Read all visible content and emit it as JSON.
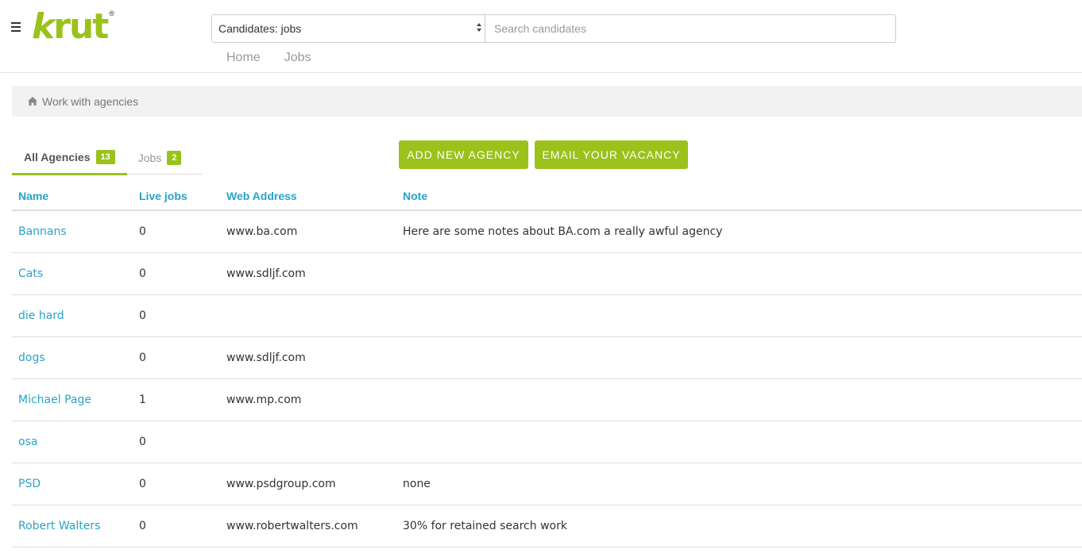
{
  "header": {
    "logo_text_k": "k",
    "logo_text_rut": "rut",
    "logo_registered": "®",
    "search_scope": "Candidates: jobs",
    "search_placeholder": "Search candidates",
    "nav": [
      "Home",
      "Jobs"
    ]
  },
  "breadcrumb": {
    "label": "Work with agencies"
  },
  "tabs": [
    {
      "label": "All Agencies",
      "count": "13"
    },
    {
      "label": "Jobs",
      "count": "2"
    }
  ],
  "buttons": {
    "add_agency": "ADD NEW AGENCY",
    "email_vacancy": "EMAIL YOUR VACANCY"
  },
  "table": {
    "columns": [
      "Name",
      "Live jobs",
      "Web Address",
      "Note"
    ],
    "rows": [
      {
        "name": "Bannans",
        "jobs": "0",
        "web": "www.ba.com",
        "note": "Here are some notes about BA.com a really awful agency"
      },
      {
        "name": "Cats",
        "jobs": "0",
        "web": "www.sdljf.com",
        "note": ""
      },
      {
        "name": "die hard",
        "jobs": "0",
        "web": "",
        "note": ""
      },
      {
        "name": "dogs",
        "jobs": "0",
        "web": "www.sdljf.com",
        "note": ""
      },
      {
        "name": "Michael Page",
        "jobs": "1",
        "web": "www.mp.com",
        "note": ""
      },
      {
        "name": "osa",
        "jobs": "0",
        "web": "",
        "note": ""
      },
      {
        "name": "PSD",
        "jobs": "0",
        "web": "www.psdgroup.com",
        "note": "none"
      },
      {
        "name": "Robert Walters",
        "jobs": "0",
        "web": "www.robertwalters.com",
        "note": "30% for retained search work"
      }
    ]
  },
  "colors": {
    "accent": "#9ac21a",
    "link": "#29a3c9"
  }
}
